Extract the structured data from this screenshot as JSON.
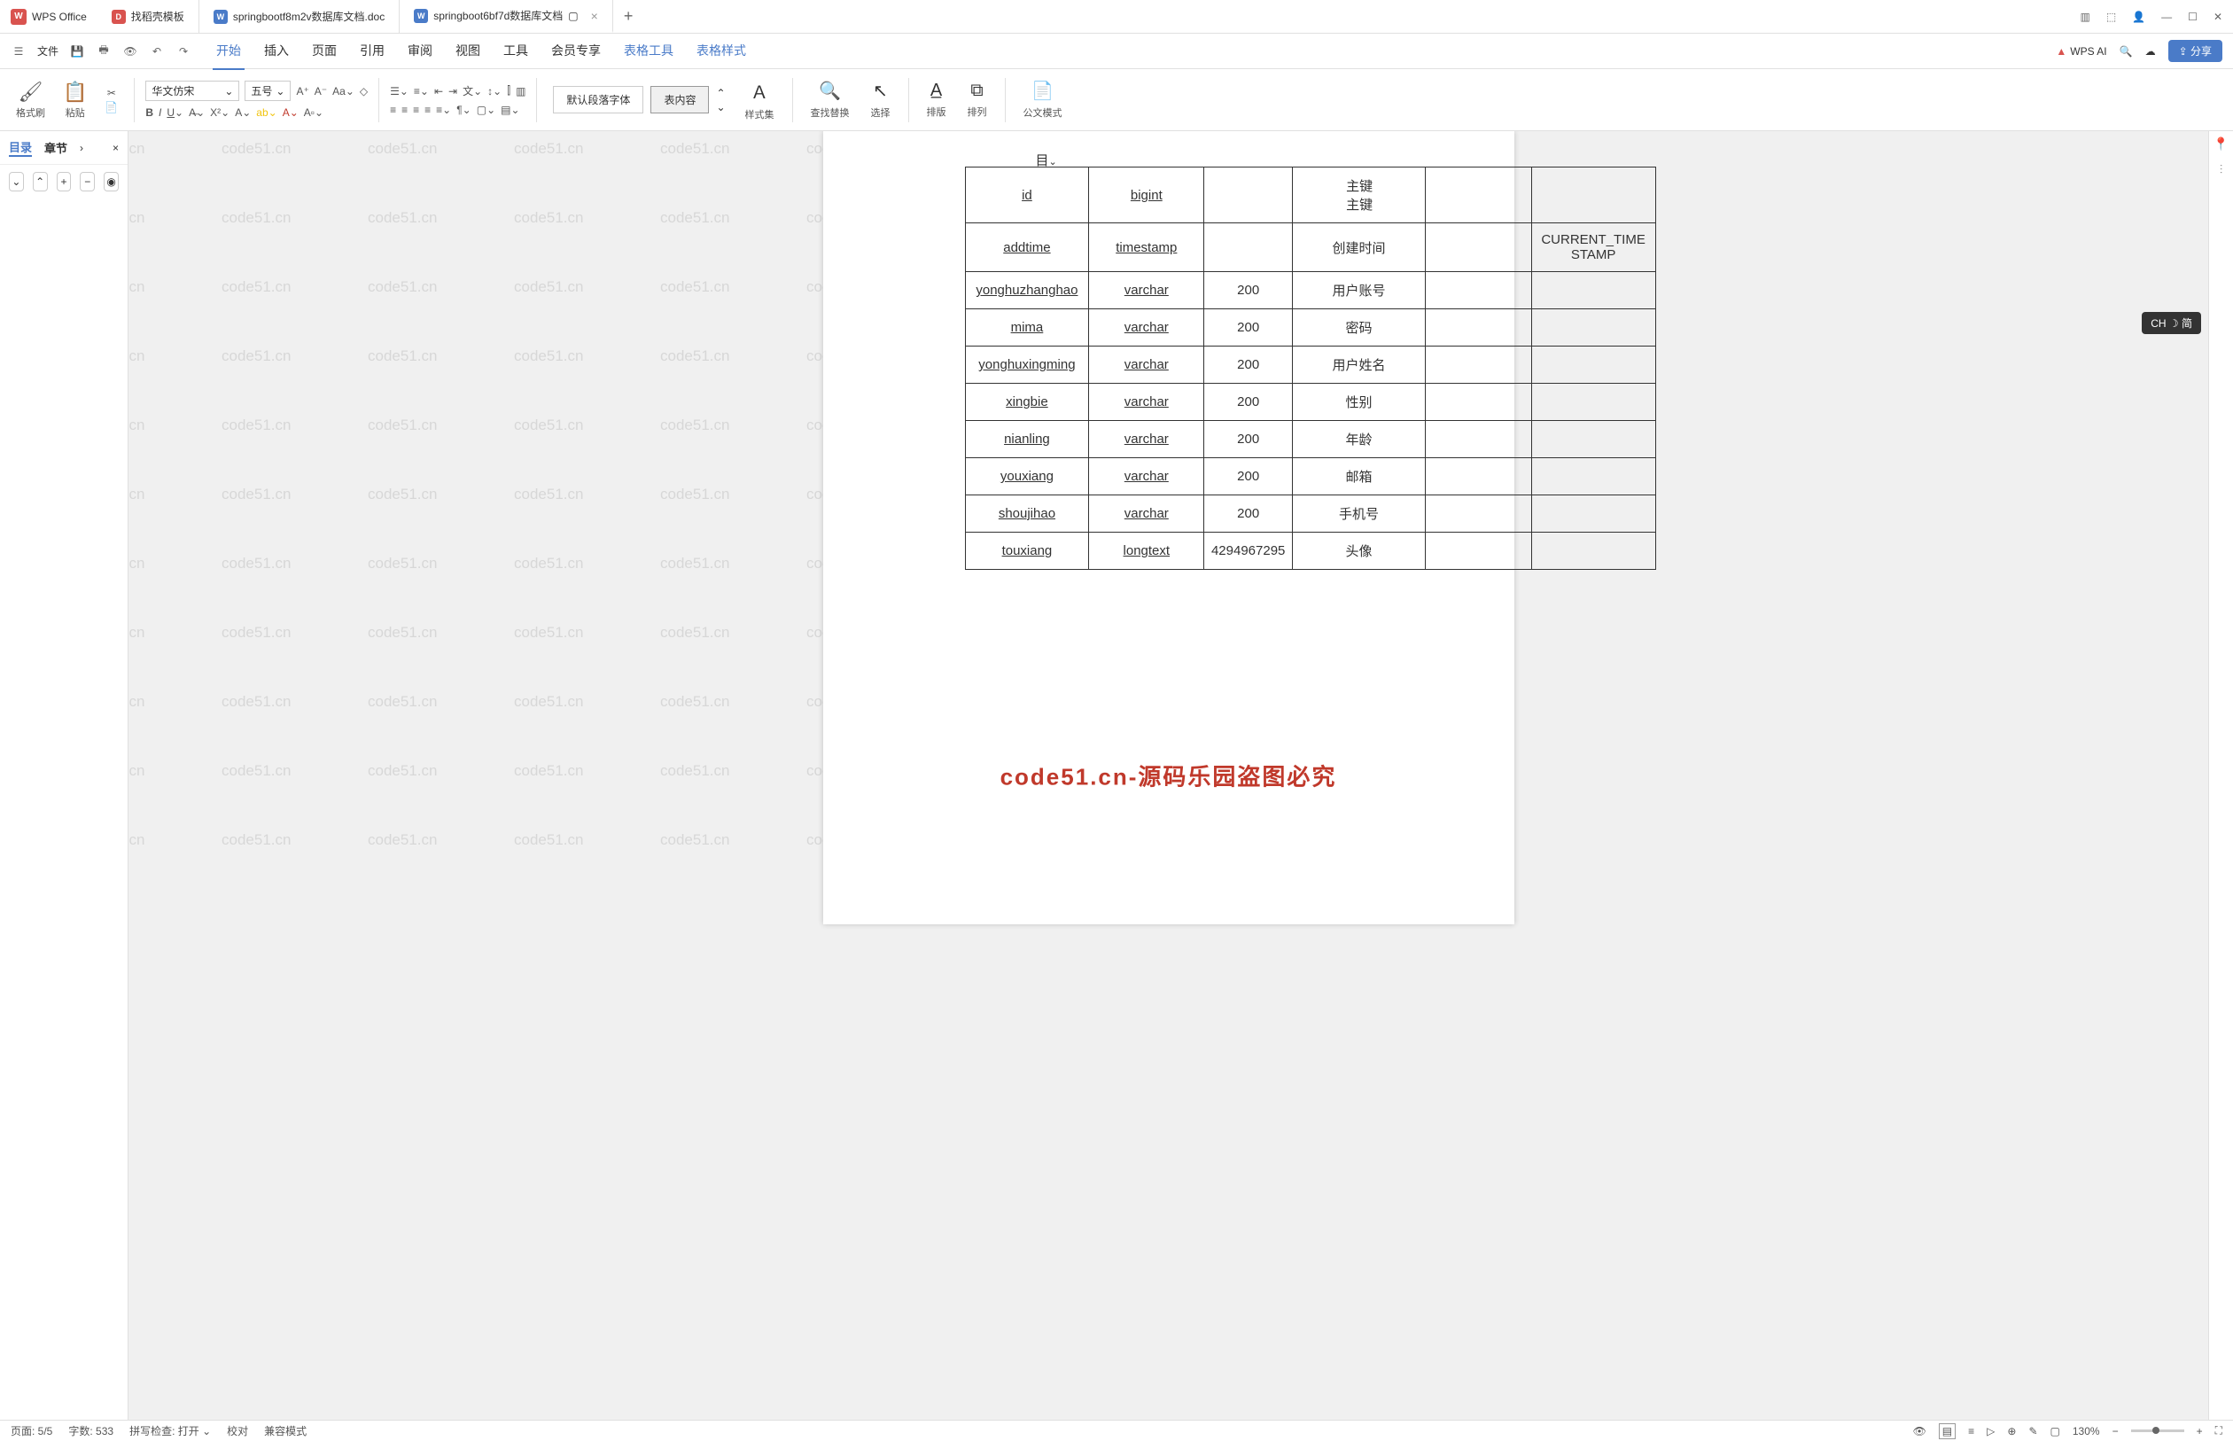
{
  "app": {
    "name": "WPS Office"
  },
  "tabs": [
    {
      "label": "找稻壳模板",
      "icon": "red"
    },
    {
      "label": "springbootf8m2v数据库文档.doc",
      "icon": "blue"
    },
    {
      "label": "springboot6bf7d数据库文档",
      "icon": "blue",
      "active": true
    }
  ],
  "menu": {
    "file": "文件",
    "items": [
      "开始",
      "插入",
      "页面",
      "引用",
      "审阅",
      "视图",
      "工具",
      "会员专享",
      "表格工具",
      "表格样式"
    ],
    "active": "开始",
    "wps_ai": "WPS AI",
    "share": "分享"
  },
  "ribbon": {
    "format_painter": "格式刷",
    "paste": "粘贴",
    "font_name": "华文仿宋",
    "font_size": "五号",
    "style_default": "默认段落字体",
    "style_content": "表内容",
    "style_set": "样式集",
    "find_replace": "查找替换",
    "select": "选择",
    "layout": "排版",
    "arrange": "排列",
    "office_mode": "公文模式"
  },
  "sidebar": {
    "tab1": "目录",
    "tab2": "章节"
  },
  "document": {
    "header_hint": "目",
    "watermark_text": "code51.cn",
    "center_watermark": "code51.cn-源码乐园盗图必究",
    "table": {
      "rows": [
        {
          "name": "id",
          "type": "bigint",
          "len": "",
          "desc": "主键\n主键",
          "c5": "",
          "c6": ""
        },
        {
          "name": "addtime",
          "type": "timestamp",
          "len": "",
          "desc": "创建时间",
          "c5": "",
          "c6": "CURRENT_TIMESTAMP"
        },
        {
          "name": "yonghuzhanghao",
          "type": "varchar",
          "len": "200",
          "desc": "用户账号",
          "c5": "",
          "c6": ""
        },
        {
          "name": "mima",
          "type": "varchar",
          "len": "200",
          "desc": "密码",
          "c5": "",
          "c6": ""
        },
        {
          "name": "yonghuxingming",
          "type": "varchar",
          "len": "200",
          "desc": "用户姓名",
          "c5": "",
          "c6": ""
        },
        {
          "name": "xingbie",
          "type": "varchar",
          "len": "200",
          "desc": "性别",
          "c5": "",
          "c6": ""
        },
        {
          "name": "nianling",
          "type": "varchar",
          "len": "200",
          "desc": "年龄",
          "c5": "",
          "c6": ""
        },
        {
          "name": "youxiang",
          "type": "varchar",
          "len": "200",
          "desc": "邮箱",
          "c5": "",
          "c6": ""
        },
        {
          "name": "shoujihao",
          "type": "varchar",
          "len": "200",
          "desc": "手机号",
          "c5": "",
          "c6": ""
        },
        {
          "name": "touxiang",
          "type": "longtext",
          "len": "4294967295",
          "desc": "头像",
          "c5": "",
          "c6": ""
        }
      ]
    }
  },
  "ime": {
    "label": "CH ☽ 简"
  },
  "status": {
    "page": "页面: 5/5",
    "words": "字数: 533",
    "spell": "拼写检查: 打开",
    "proof": "校对",
    "compat": "兼容模式",
    "zoom": "130%"
  }
}
